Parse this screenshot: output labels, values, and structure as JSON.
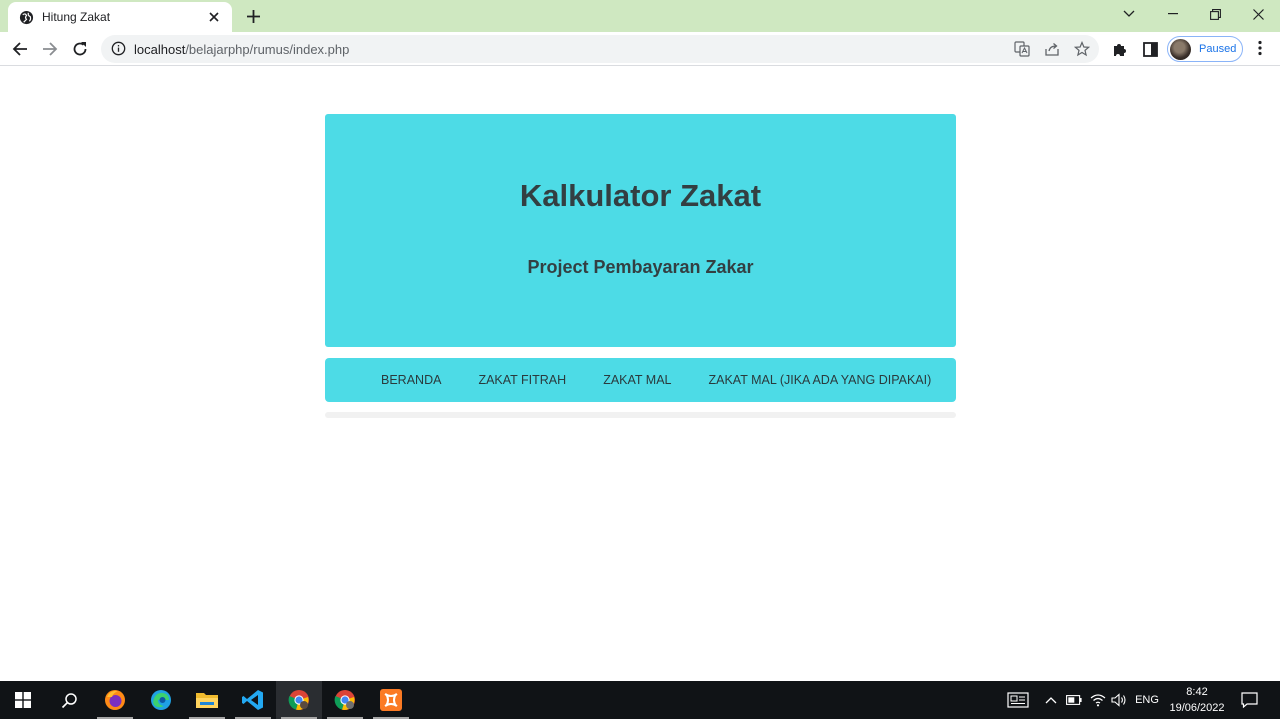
{
  "browser": {
    "tab_title": "Hitung Zakat",
    "url_host": "localhost",
    "url_path": "/belajarphp/rumus/index.php",
    "profile_status": "Paused"
  },
  "page": {
    "hero_title": "Kalkulator Zakat",
    "hero_subtitle": "Project Pembayaran Zakar",
    "nav": [
      {
        "label": "BERANDA"
      },
      {
        "label": "ZAKAT FITRAH"
      },
      {
        "label": "ZAKAT MAL"
      },
      {
        "label": "ZAKAT MAL (JIKA ADA YANG DIPAKAI)"
      }
    ],
    "accent_color": "#4ddbe6"
  },
  "taskbar": {
    "apps": [
      "start-icon",
      "search-icon",
      "firefox-icon",
      "edge-icon",
      "file-explorer-icon",
      "vscode-icon",
      "chrome-icon",
      "chrome-profile-icon",
      "xampp-icon"
    ],
    "language": "ENG",
    "time": "8:42",
    "date": "19/06/2022"
  }
}
